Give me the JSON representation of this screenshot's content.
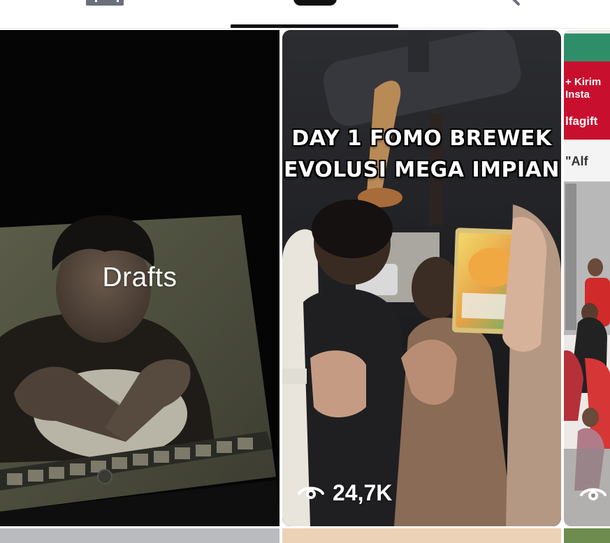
{
  "tabs": [
    {
      "name": "grid",
      "icon": "grid-icon",
      "active": false
    },
    {
      "name": "private",
      "icon": "lock-icon",
      "active": true
    },
    {
      "name": "search",
      "icon": "search-icon",
      "active": false
    }
  ],
  "drafts_tile": {
    "label": "Drafts"
  },
  "video_tile": {
    "caption_line1": "DAY 1 FOMO BREWEK",
    "caption_line2": "EVOLUSI MEGA IMPIAN",
    "views": "24,7K",
    "views_icon": "eye-icon"
  },
  "peek_tile": {
    "sign_line1": "+ Kirim",
    "sign_line2": "Insta",
    "sign_line3": "lfagift",
    "sign_line4": "\"Alf",
    "views_icon": "eye-icon"
  },
  "colors": {
    "accent": "#111111",
    "sign_red": "#c8102e"
  }
}
